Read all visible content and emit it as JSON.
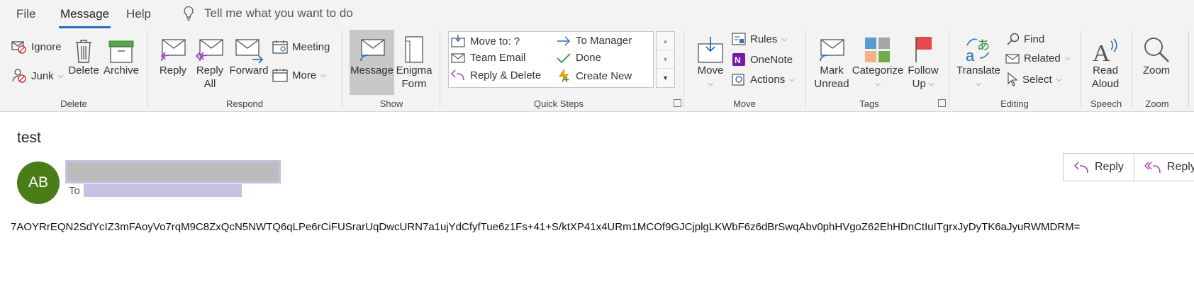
{
  "menu": {
    "file": "File",
    "message": "Message",
    "help": "Help",
    "tell_me": "Tell me what you want to do"
  },
  "ribbon": {
    "delete_group": {
      "label": "Delete",
      "ignore": "Ignore",
      "junk": "Junk",
      "delete": "Delete",
      "archive": "Archive"
    },
    "respond_group": {
      "label": "Respond",
      "reply": "Reply",
      "reply_all_1": "Reply",
      "reply_all_2": "All",
      "forward": "Forward",
      "meeting": "Meeting",
      "more": "More"
    },
    "show_group": {
      "label": "Show",
      "message": "Message",
      "enigma_1": "Enigma",
      "enigma_2": "Form"
    },
    "quick_steps_group": {
      "label": "Quick Steps",
      "move_to": "Move to: ?",
      "team_email": "Team Email",
      "reply_delete": "Reply & Delete",
      "to_manager": "To Manager",
      "done": "Done",
      "create_new": "Create New"
    },
    "move_group": {
      "label": "Move",
      "move": "Move",
      "rules": "Rules",
      "onenote": "OneNote",
      "actions": "Actions"
    },
    "tags_group": {
      "label": "Tags",
      "mark_unread_1": "Mark",
      "mark_unread_2": "Unread",
      "categorize": "Categorize",
      "follow_up_1": "Follow",
      "follow_up_2": "Up"
    },
    "editing_group": {
      "label": "Editing",
      "translate": "Translate",
      "find": "Find",
      "related": "Related",
      "select": "Select"
    },
    "speech_group": {
      "label": "Speech",
      "read_aloud_1": "Read",
      "read_aloud_2": "Aloud"
    },
    "zoom_group": {
      "label": "Zoom",
      "zoom": "Zoom"
    }
  },
  "message": {
    "subject": "test",
    "avatar_initials": "AB",
    "to_label": "To",
    "reply": "Reply",
    "reply_all": "Reply",
    "body": "7AOYRrEQN2SdYcIZ3mFAoyVo7rqM9C8ZxQcN5NWTQ6qLPe6rCiFUSrarUqDwcURN7a1ujYdCfyfTue6z1Fs+41+S/ktXP41x4URm1MCOf9GJCjplgLKWbF6z6dBrSwqAbv0phHVgoZ62EhHDnCtIuITgrxJyDyTK6aJyuRWMDRM="
  },
  "colors": {
    "accent": "#2b6cbf",
    "avatar": "#4a7c17",
    "redaction": "#c5c1e1"
  }
}
